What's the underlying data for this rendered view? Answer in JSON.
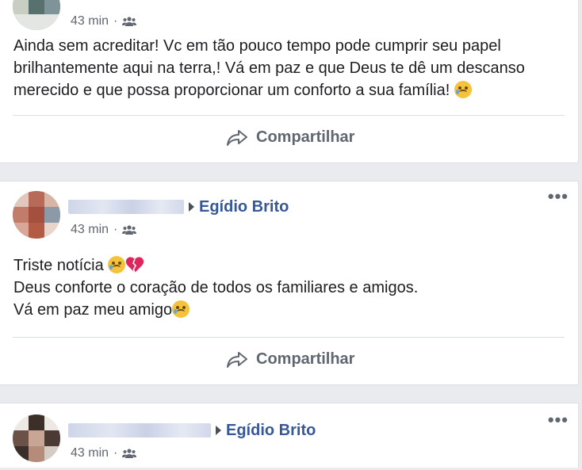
{
  "colors": {
    "link": "#365899",
    "text": "#1c1e21",
    "meta": "#616770",
    "action": "#606770"
  },
  "posts": [
    {
      "time": "43 min",
      "audience_icon": "group-icon",
      "body": [
        "Ainda sem acreditar! Vc em tão pouco tempo pode cumprir seu papel",
        "brilhantemente aqui na terra,! Vá em paz e que Deus te dê um descanso",
        "merecido e que possa proporcionar um conforto a sua família!"
      ],
      "share_label": "Compartilhar"
    },
    {
      "target": "Egídio Brito",
      "time": "43 min",
      "audience_icon": "group-icon",
      "body": [
        "Triste notícia",
        "Deus conforte o coração de todos os familiares e amigos.",
        "Vá em paz meu amigo"
      ],
      "share_label": "Compartilhar",
      "more_label": "•••"
    },
    {
      "target": "Egídio Brito",
      "time": "43 min",
      "audience_icon": "group-icon",
      "more_label": "•••"
    }
  ]
}
